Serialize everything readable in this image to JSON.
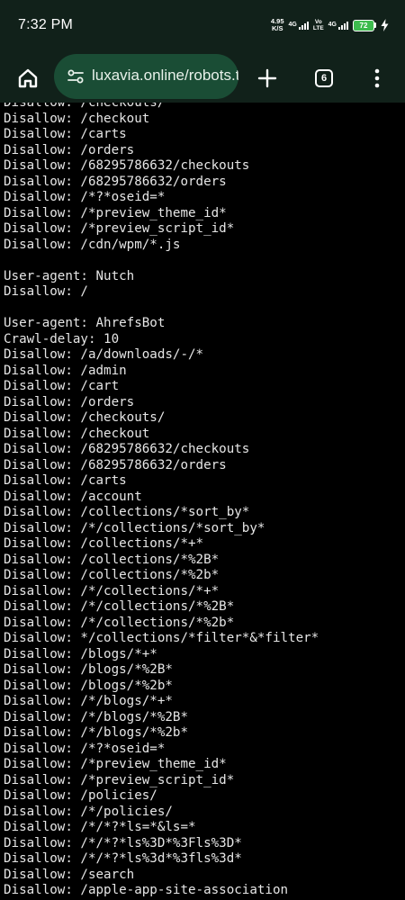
{
  "status_bar": {
    "time": "7:32 PM",
    "net_speed_value": "4.95",
    "net_speed_unit": "K/S",
    "sim1_label": "4G",
    "volte_top": "Vo",
    "volte_bottom": "LTE",
    "sim2_label": "4G",
    "battery_level": "72"
  },
  "toolbar": {
    "home_icon": "home-icon",
    "url": "luxavia.online/robots.txt",
    "tune_icon": "site-settings-icon",
    "new_tab_icon": "plus-icon",
    "tab_count": "6",
    "menu_icon": "more-vert-icon"
  },
  "content": {
    "lines": [
      "Disallow: /checkouts/",
      "Disallow: /checkout",
      "Disallow: /carts",
      "Disallow: /orders",
      "Disallow: /68295786632/checkouts",
      "Disallow: /68295786632/orders",
      "Disallow: /*?*oseid=*",
      "Disallow: /*preview_theme_id*",
      "Disallow: /*preview_script_id*",
      "Disallow: /cdn/wpm/*.js",
      "",
      "User-agent: Nutch",
      "Disallow: /",
      "",
      "User-agent: AhrefsBot",
      "Crawl-delay: 10",
      "Disallow: /a/downloads/-/*",
      "Disallow: /admin",
      "Disallow: /cart",
      "Disallow: /orders",
      "Disallow: /checkouts/",
      "Disallow: /checkout",
      "Disallow: /68295786632/checkouts",
      "Disallow: /68295786632/orders",
      "Disallow: /carts",
      "Disallow: /account",
      "Disallow: /collections/*sort_by*",
      "Disallow: /*/collections/*sort_by*",
      "Disallow: /collections/*+*",
      "Disallow: /collections/*%2B*",
      "Disallow: /collections/*%2b*",
      "Disallow: /*/collections/*+*",
      "Disallow: /*/collections/*%2B*",
      "Disallow: /*/collections/*%2b*",
      "Disallow: */collections/*filter*&*filter*",
      "Disallow: /blogs/*+*",
      "Disallow: /blogs/*%2B*",
      "Disallow: /blogs/*%2b*",
      "Disallow: /*/blogs/*+*",
      "Disallow: /*/blogs/*%2B*",
      "Disallow: /*/blogs/*%2b*",
      "Disallow: /*?*oseid=*",
      "Disallow: /*preview_theme_id*",
      "Disallow: /*preview_script_id*",
      "Disallow: /policies/",
      "Disallow: /*/policies/",
      "Disallow: /*/*?*ls=*&ls=*",
      "Disallow: /*/*?*ls%3D*%3Fls%3D*",
      "Disallow: /*/*?*ls%3d*%3fls%3d*",
      "Disallow: /search",
      "Disallow: /apple-app-site-association"
    ]
  }
}
